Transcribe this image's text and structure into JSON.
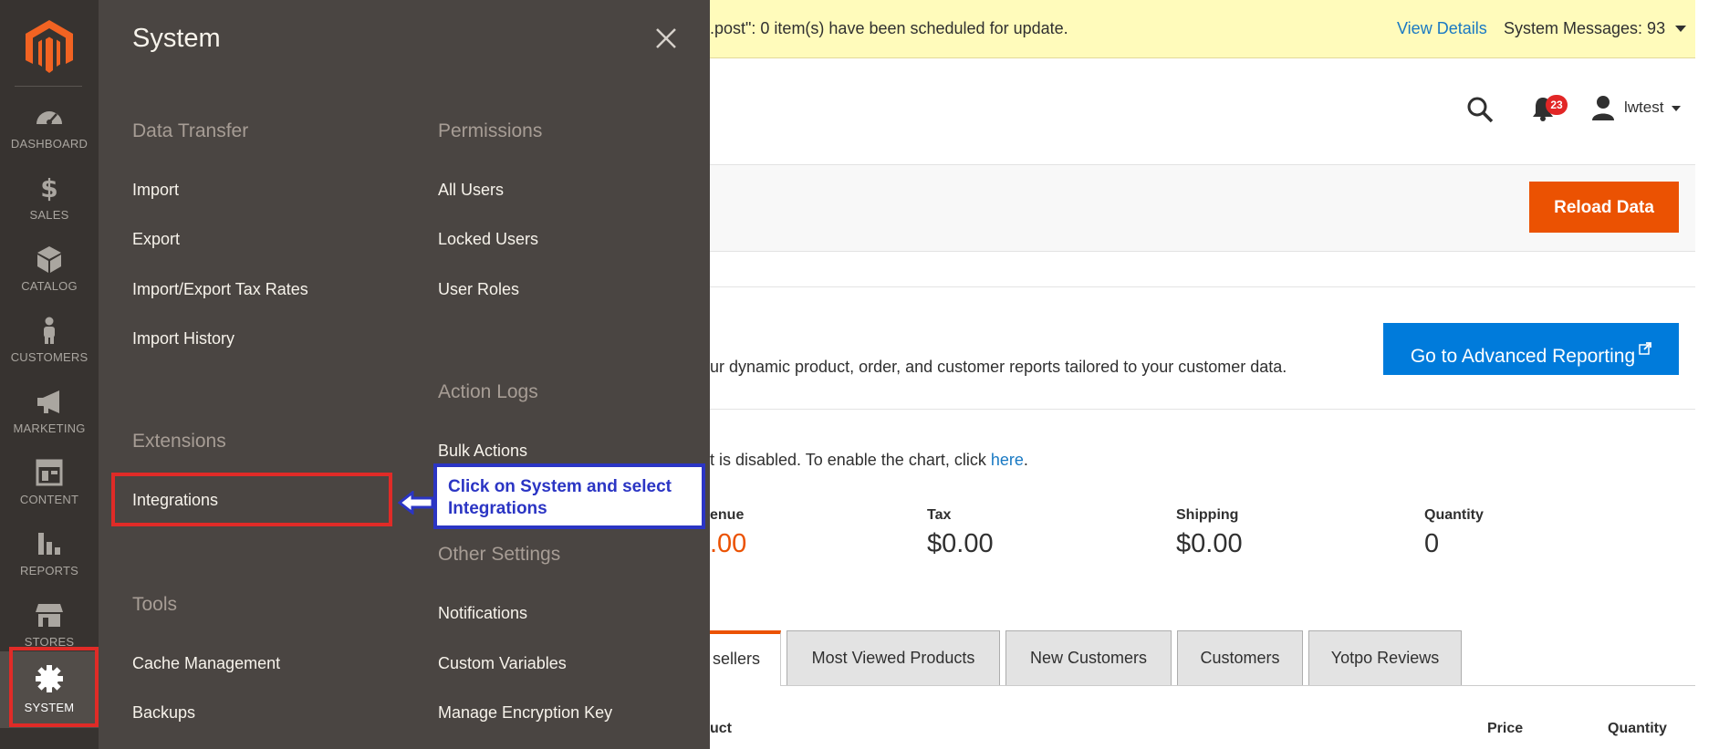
{
  "nav": {
    "items": [
      {
        "label": "DASHBOARD",
        "icon": "dashboard-icon"
      },
      {
        "label": "SALES",
        "icon": "dollar-icon"
      },
      {
        "label": "CATALOG",
        "icon": "box-icon"
      },
      {
        "label": "CUSTOMERS",
        "icon": "person-icon"
      },
      {
        "label": "MARKETING",
        "icon": "megaphone-icon"
      },
      {
        "label": "CONTENT",
        "icon": "layout-icon"
      },
      {
        "label": "REPORTS",
        "icon": "bar-chart-icon"
      },
      {
        "label": "STORES",
        "icon": "store-icon"
      },
      {
        "label": "SYSTEM",
        "icon": "gear-icon"
      }
    ],
    "active": "SYSTEM"
  },
  "flyout": {
    "title": "System",
    "sections": {
      "data_transfer": {
        "title": "Data Transfer",
        "links": [
          "Import",
          "Export",
          "Import/Export Tax Rates",
          "Import History"
        ]
      },
      "extensions": {
        "title": "Extensions",
        "links": [
          "Integrations"
        ]
      },
      "tools": {
        "title": "Tools",
        "links": [
          "Cache Management",
          "Backups"
        ]
      },
      "permissions": {
        "title": "Permissions",
        "links": [
          "All Users",
          "Locked Users",
          "User Roles"
        ]
      },
      "action_logs": {
        "title": "Action Logs",
        "links": [
          "Bulk Actions"
        ]
      },
      "other_settings": {
        "title": "Other Settings",
        "links": [
          "Notifications",
          "Custom Variables",
          "Manage Encryption Key"
        ]
      }
    }
  },
  "callout": {
    "text": "Click on System and select Integrations"
  },
  "message_bar": {
    "text": ".post\": 0 item(s) have been scheduled for update.",
    "view_details": "View Details",
    "system_messages": "System Messages: 93"
  },
  "header": {
    "notification_count": "23",
    "username": "lwtest"
  },
  "actions": {
    "reload": "Reload Data"
  },
  "advanced_reporting": {
    "text": "ur dynamic product, order, and customer reports tailored to your customer data.",
    "button": "Go to Advanced Reporting"
  },
  "chart_notice": {
    "text": "t is disabled. To enable the chart, click ",
    "link": "here",
    "end": "."
  },
  "stats": [
    {
      "label": "enue",
      "value": ".00"
    },
    {
      "label": "Tax",
      "value": "$0.00"
    },
    {
      "label": "Shipping",
      "value": "$0.00"
    },
    {
      "label": "Quantity",
      "value": "0"
    }
  ],
  "tabs": [
    "sellers",
    "Most Viewed Products",
    "New Customers",
    "Customers",
    "Yotpo Reviews"
  ],
  "table": {
    "headers": [
      "uct",
      "Price",
      "Quantity"
    ]
  },
  "colors": {
    "accent": "#eb5202",
    "link": "#1979c3",
    "nav_bg": "#373330",
    "flyout_bg": "#4a4542",
    "highlight": "#e02b27",
    "callout": "#2b35c4"
  }
}
